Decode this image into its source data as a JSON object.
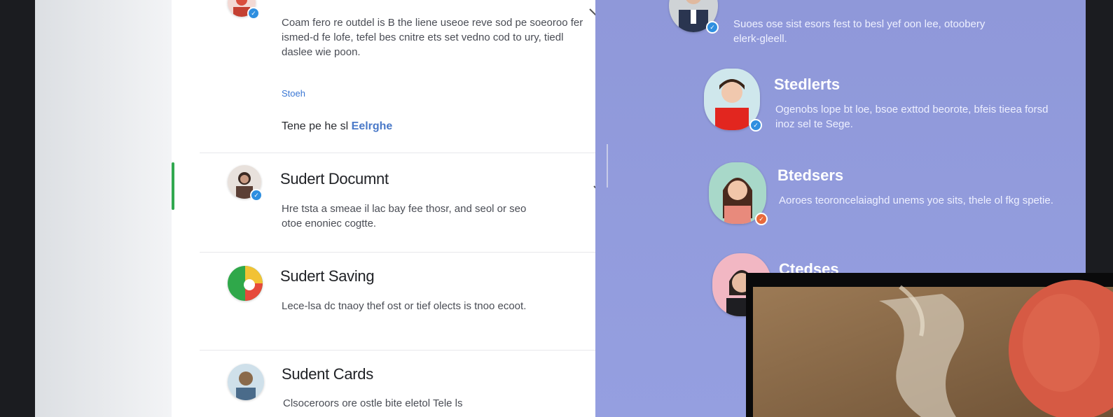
{
  "list_panel": {
    "items": [
      {
        "title": "",
        "description": "Coam fero re outdel is B the liene useoe reve sod pe soeoroo fer ismed-d fe lofe, tefel bes cnitre ets set vedno cod to ury, tiedl daslee wie poon.",
        "link": "Stoeh",
        "footer_text": "Tene pe he sl",
        "footer_link": "Eelrghe"
      },
      {
        "title": "Sudert Documnt",
        "description": "Hre tsta a smeae il lac bay fee thosr, and seol or seo otoe enoniec cogtte."
      },
      {
        "title": "Sudert Saving",
        "description": "Lece-lsa dc tnaoy thef ost or tief olects is tnoo ecoot."
      },
      {
        "title": "Sudent Cards",
        "description": "Clsoceroors ore ostle bite eletol Tele ls"
      }
    ]
  },
  "right_panel": {
    "items": [
      {
        "title": "",
        "description": "Suoes ose sist esors fest to besl yef oon lee, otoobery elerk-gleell."
      },
      {
        "title": "Stedlerts",
        "description": "Ogenobs lope bt loe, bsoe exttod beorote, bfeis tieea forsd inoz sel te Sege."
      },
      {
        "title": "Btedsers",
        "description": "Aoroes teoroncelaiaghd unems yoe sits, thele ol fkg spetie."
      },
      {
        "title": "Ctedses",
        "description": ""
      }
    ]
  },
  "colors": {
    "accent": "#31a84f",
    "panel_blue": "#8f98d9",
    "badge": "#2f8fe0"
  }
}
